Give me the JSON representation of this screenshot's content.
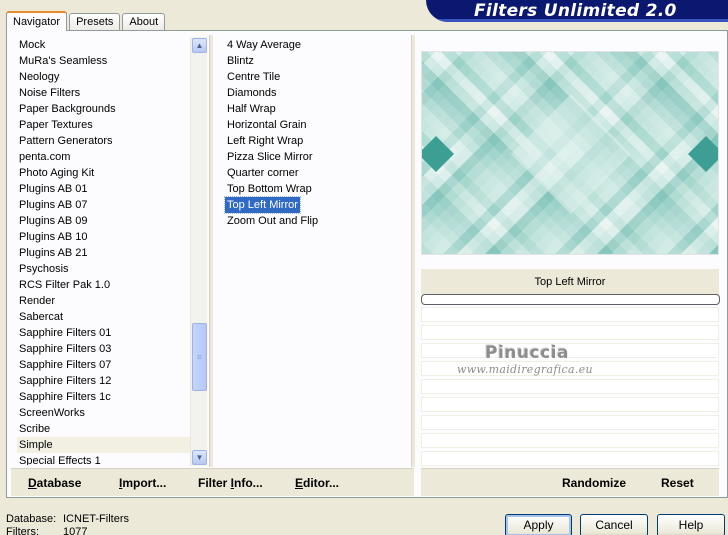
{
  "tabs": [
    {
      "label": "Navigator",
      "active": true
    },
    {
      "label": "Presets",
      "active": false
    },
    {
      "label": "About",
      "active": false
    }
  ],
  "banner": {
    "title": "Filters Unlimited 2.0"
  },
  "categories": {
    "items": [
      "Mock",
      "MuRa's Seamless",
      "Neology",
      "Noise Filters",
      "Paper Backgrounds",
      "Paper Textures",
      "Pattern Generators",
      "penta.com",
      "Photo Aging Kit",
      "Plugins AB 01",
      "Plugins AB 07",
      "Plugins AB 09",
      "Plugins AB 10",
      "Plugins AB 21",
      "Psychosis",
      "RCS Filter Pak 1.0",
      "Render",
      "Sabercat",
      "Sapphire Filters 01",
      "Sapphire Filters 03",
      "Sapphire Filters 07",
      "Sapphire Filters 12",
      "Sapphire Filters 1c",
      "ScreenWorks",
      "Scribe",
      "Simple",
      "Special Effects 1"
    ],
    "selected": "Simple"
  },
  "filters": {
    "items": [
      "4 Way Average",
      "Blintz",
      "Centre Tile",
      "Diamonds",
      "Half Wrap",
      "Horizontal Grain",
      "Left Right Wrap",
      "Pizza Slice Mirror",
      "Quarter corner",
      "Top Bottom Wrap",
      "Top Left Mirror",
      "Zoom Out and Flip"
    ],
    "selected": "Top Left Mirror"
  },
  "preview": {
    "filter_name": "Top Left Mirror"
  },
  "watermark": {
    "name": "Pinuccia",
    "site": "www.maidiregrafica.eu"
  },
  "toolbar": {
    "database": {
      "u": "D",
      "rest": "atabase"
    },
    "import": {
      "u": "I",
      "rest": "mport..."
    },
    "filter_info": {
      "pre": "Filter ",
      "u": "I",
      "rest": "nfo..."
    },
    "editor": {
      "u": "E",
      "rest": "ditor..."
    },
    "randomize": "Randomize",
    "reset": "Reset"
  },
  "status": {
    "database_label": "Database:",
    "database_value": "ICNET-Filters",
    "filters_label": "Filters:",
    "filters_value": "1077"
  },
  "buttons": {
    "apply": "Apply",
    "cancel": "Cancel",
    "help": "Help"
  },
  "colors": {
    "selection": "#316ac5",
    "banner": "#0a1870",
    "teal_dark": "#3d9e93",
    "teal_light": "#dff0ed",
    "face": "#ece9d8"
  }
}
